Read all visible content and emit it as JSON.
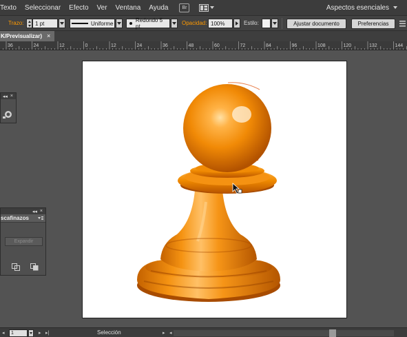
{
  "menubar": {
    "items": [
      "Texto",
      "Seleccionar",
      "Efecto",
      "Ver",
      "Ventana",
      "Ayuda"
    ],
    "bridge_label": "Br",
    "workspace_label": "Aspectos esenciales"
  },
  "controlbar": {
    "stroke_label": "Trazo:",
    "stroke_weight": "1 pt",
    "profile_label": "Uniforme",
    "brush_label": "Redondo 5 pt.",
    "opacity_label": "Opacidad:",
    "opacity_value": "100%",
    "style_label": "Estilo:",
    "fit_button": "Ajustar documento",
    "prefs_button": "Preferencias"
  },
  "document": {
    "tab_title": "K/Previsualizar)",
    "close_glyph": "×"
  },
  "ruler": {
    "labels": [
      "36",
      "24",
      "12",
      "0",
      "12",
      "24",
      "36",
      "48",
      "60",
      "72",
      "84",
      "96",
      "108",
      "120",
      "132",
      "144"
    ]
  },
  "panels": {
    "collapse_glyph": "◂◂",
    "close_glyph": "×",
    "pathfinder_title": "scafinazos",
    "expand_button": "Expandir"
  },
  "statusbar": {
    "zoom_value": "1",
    "tool_label": "Selección"
  },
  "colors": {
    "accent_label": "#ff9a00",
    "pawn_base": "#f08a00",
    "pawn_highlight": "#ffcf7a",
    "pawn_shadow": "#b85400"
  },
  "icons": [
    "layout-icon",
    "menu-icon",
    "shape-modes-icon",
    "divide-icon",
    "merge-icon",
    "hand-cursor-icon"
  ]
}
